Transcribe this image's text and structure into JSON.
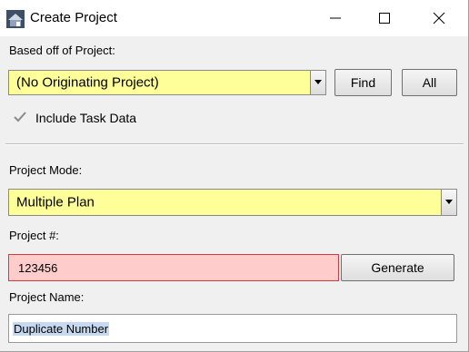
{
  "window": {
    "title": "Create Project"
  },
  "based_off": {
    "label": "Based off of Project:",
    "selected": "(No Originating Project)",
    "find_label": "Find",
    "all_label": "All"
  },
  "include_task_data": {
    "label": "Include Task Data",
    "checked": true
  },
  "project_mode": {
    "label": "Project Mode:",
    "selected": "Multiple Plan"
  },
  "project_number": {
    "label": "Project #:",
    "value": "123456",
    "generate_label": "Generate"
  },
  "project_name": {
    "label": "Project Name:",
    "value": "Duplicate Number"
  },
  "colors": {
    "highlight_yellow": "#ffff99",
    "error_red": "#ffcccc",
    "error_border": "#d23b3b",
    "selection": "#c7d9f1"
  }
}
